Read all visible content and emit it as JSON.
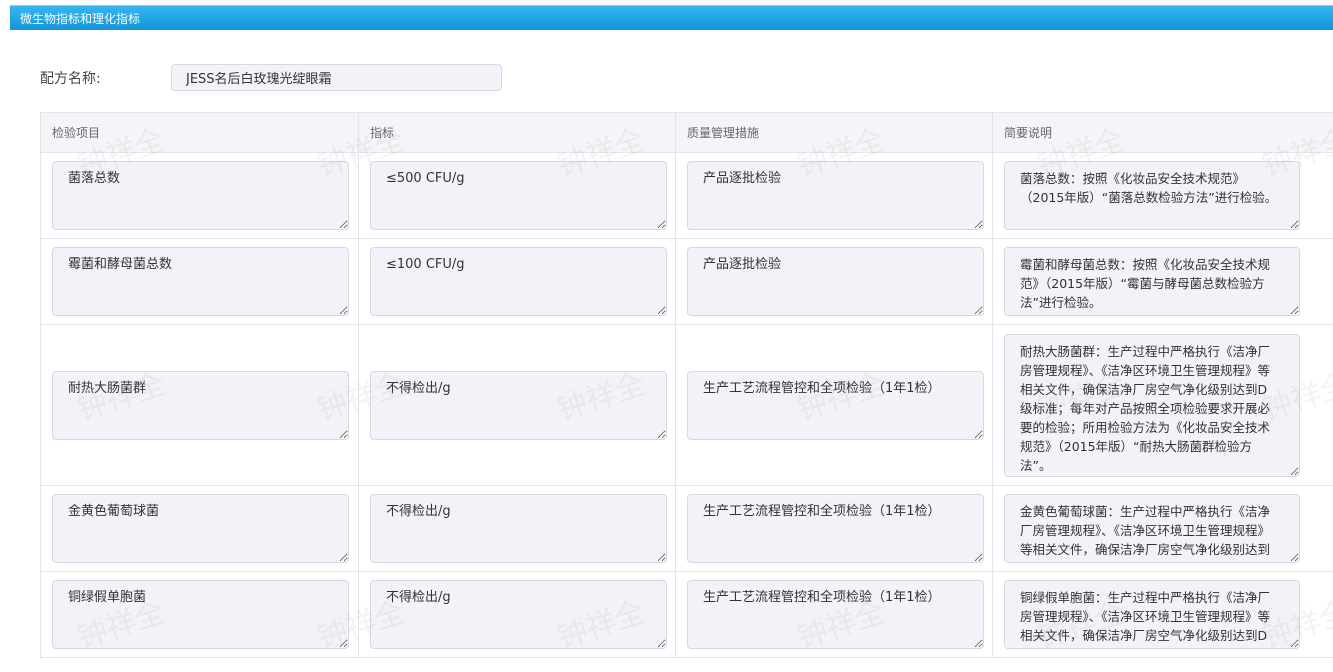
{
  "header": {
    "title": "微生物指标和理化指标"
  },
  "form": {
    "label": "配方名称:",
    "value": "JESS名后白玫瑰光绽眼霜"
  },
  "table": {
    "columns": [
      "检验项目",
      "指标",
      "质量管理措施",
      "简要说明"
    ],
    "rows": [
      {
        "item": "菌落总数",
        "spec": "≤500 CFU/g",
        "measure": "产品逐批检验",
        "desc": "菌落总数：按照《化妆品安全技术规范》（2015年版）“菌落总数检验方法”进行检验。"
      },
      {
        "item": "霉菌和酵母菌总数",
        "spec": "≤100 CFU/g",
        "measure": "产品逐批检验",
        "desc": "霉菌和酵母菌总数：按照《化妆品安全技术规范》（2015年版）“霉菌与酵母菌总数检验方法”进行检验。"
      },
      {
        "item": "耐热大肠菌群",
        "spec": "不得检出/g",
        "measure": "生产工艺流程管控和全项检验（1年1检）",
        "desc": "耐热大肠菌群：生产过程中严格执行《洁净厂房管理规程》、《洁净区环境卫生管理规程》等相关文件，确保洁净厂房空气净化级别达到D级标准；每年对产品按照全项检验要求开展必要的检验；所用检验方法为《化妆品安全技术规范》（2015年版）“耐热大肠菌群检验方法”。"
      },
      {
        "item": "金黄色葡萄球菌",
        "spec": "不得检出/g",
        "measure": "生产工艺流程管控和全项检验（1年1检）",
        "desc": "金黄色葡萄球菌：生产过程中严格执行《洁净厂房管理规程》、《洁净区环境卫生管理规程》等相关文件，确保洁净厂房空气净化级别达到D级标准；"
      },
      {
        "item": "铜绿假单胞菌",
        "spec": "不得检出/g",
        "measure": "生产工艺流程管控和全项检验（1年1检）",
        "desc": "铜绿假单胞菌：生产过程中严格执行《洁净厂房管理规程》、《洁净区环境卫生管理规程》等相关文件，确保洁净厂房空气净化级别达到D级标准；"
      }
    ]
  },
  "watermark": {
    "text": "钟祥全"
  }
}
